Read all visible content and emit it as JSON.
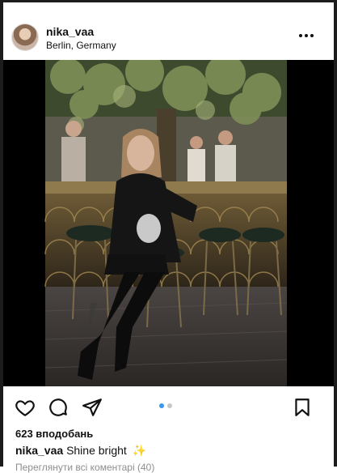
{
  "post": {
    "username": "nika_vaa",
    "location": "Berlin, Germany",
    "likes_text": "623 вподобань",
    "caption_username": "nika_vaa",
    "caption_text": "Shine bright",
    "caption_emoji": "✨",
    "view_comments_text": "Переглянути всі коментарі (40)",
    "carousel": {
      "count": 2,
      "active": 1
    }
  },
  "icons": {
    "more": "more-horizontal-icon",
    "like": "heart-icon",
    "comment": "comment-icon",
    "share": "send-icon",
    "save": "bookmark-icon"
  },
  "colors": {
    "text": "#111111",
    "secondary_text": "#8e8e8e",
    "active_dot": "#3897f0",
    "inactive_dot": "#c7c7c7",
    "frame": "#1c1c1c"
  }
}
